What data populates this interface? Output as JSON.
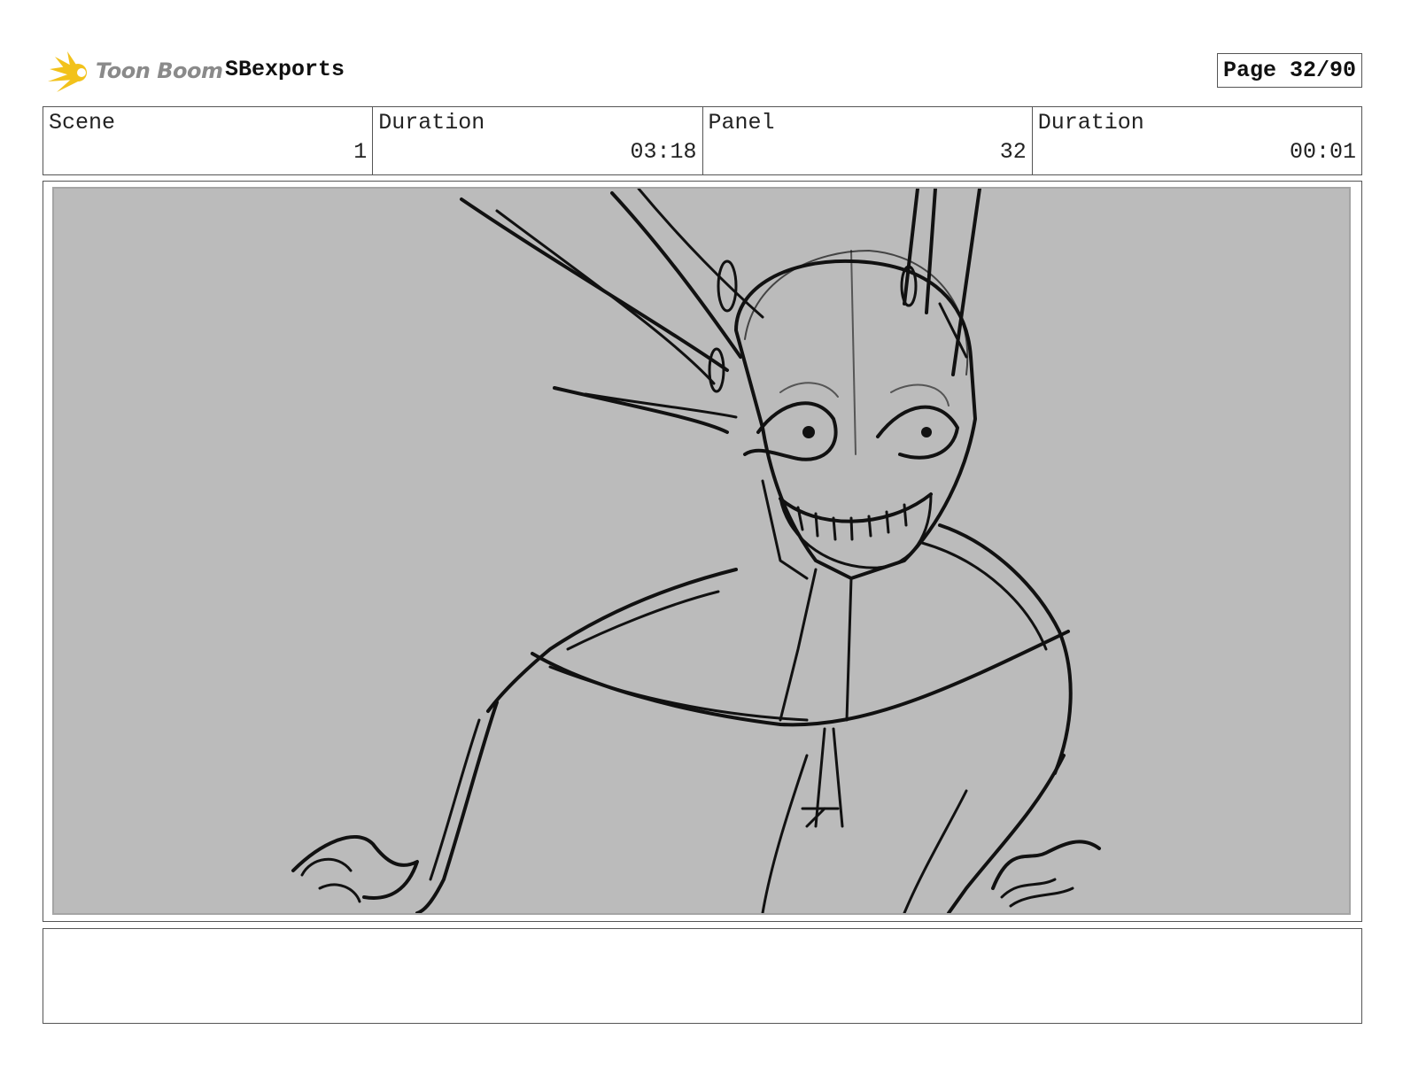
{
  "header": {
    "brand": "Toon Boom",
    "project": "SBexports",
    "page": "Page 32/90"
  },
  "info": {
    "scene_label": "Scene",
    "scene_value": "1",
    "scene_duration_label": "Duration",
    "scene_duration_value": "03:18",
    "panel_label": "Panel",
    "panel_value": "32",
    "panel_duration_label": "Duration",
    "panel_duration_value": "00:01"
  },
  "notes": {
    "text": ""
  },
  "colors": {
    "panel_bg": "#bbbbbb",
    "sketch": "#111111",
    "logo_yellow": "#f2c21b"
  }
}
